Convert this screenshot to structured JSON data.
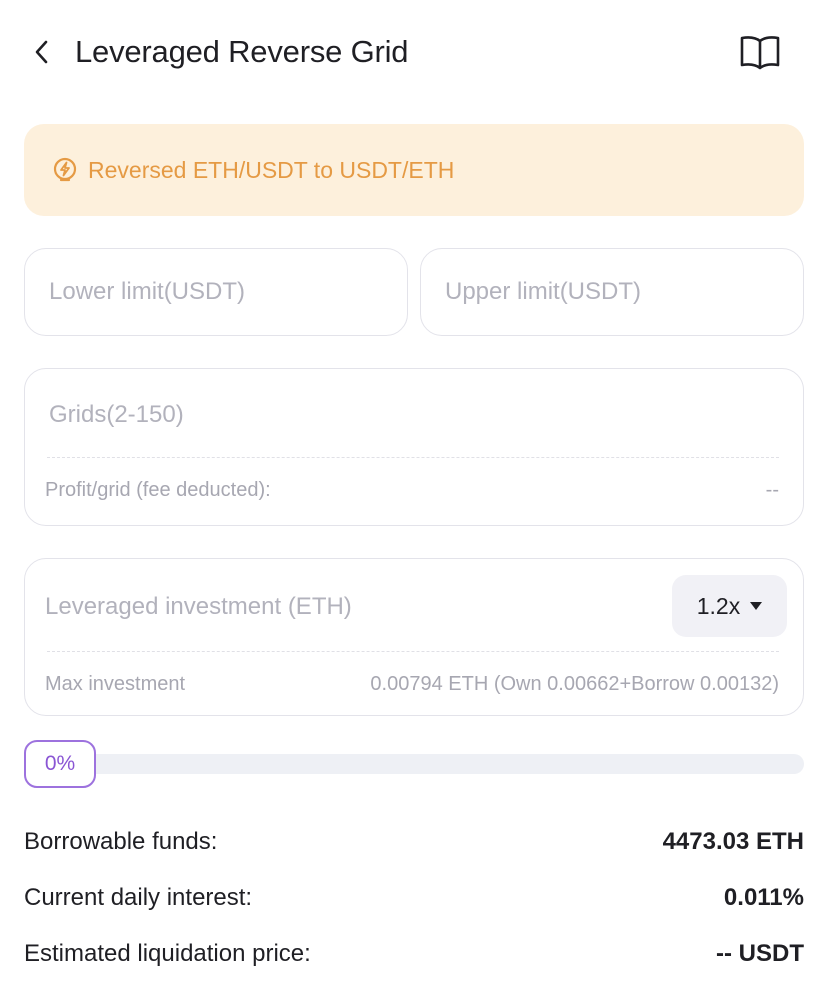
{
  "header": {
    "title": "Leveraged Reverse Grid",
    "back_icon": "chevron-left-icon",
    "guide_icon": "book-open-icon"
  },
  "notice": {
    "icon": "lightning-icon",
    "text": "Reversed ETH/USDT to USDT/ETH",
    "color": "#e59a44",
    "background": "#fdf0dc"
  },
  "form": {
    "lower_limit": {
      "placeholder": "Lower limit(USDT)",
      "value": ""
    },
    "upper_limit": {
      "placeholder": "Upper limit(USDT)",
      "value": ""
    },
    "grids": {
      "placeholder": "Grids(2-150)",
      "value": "",
      "profit_label": "Profit/grid (fee deducted):",
      "profit_value": "--"
    },
    "investment": {
      "placeholder": "Leveraged investment (ETH)",
      "value": "",
      "leverage": "1.2x",
      "max_label": "Max investment",
      "max_value": "0.00794 ETH (Own 0.00662+Borrow 0.00132)"
    },
    "slider": {
      "percent_label": "0%",
      "value": 0,
      "accent": "#9d72de"
    }
  },
  "info": {
    "borrowable_label": "Borrowable funds:",
    "borrowable_value": "4473.03 ETH",
    "interest_label": "Current daily interest:",
    "interest_value": "0.011%",
    "liquidation_label": "Estimated liquidation price:",
    "liquidation_value": "-- USDT"
  }
}
